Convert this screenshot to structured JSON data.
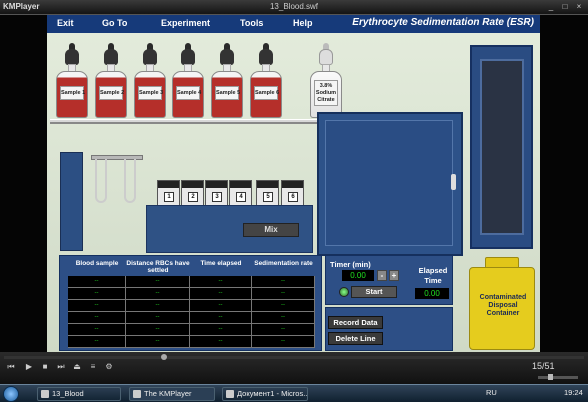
{
  "window": {
    "app_name": "KMPlayer",
    "file_title": "13_Blood.swf",
    "buttons": [
      "_",
      "□",
      "×"
    ]
  },
  "menu": {
    "items": [
      "Exit",
      "Go To",
      "Experiment",
      "Tools",
      "Help"
    ],
    "app_title": "Erythrocyte Sedimentation Rate (ESR)"
  },
  "bottles": [
    "Sample 1",
    "Sample 2",
    "Sample 3",
    "Sample 4",
    "Sample 5",
    "Sample 6"
  ],
  "citrate_label": "3.8% Sodium Citrate",
  "slots": [
    "1",
    "2",
    "3",
    "4",
    "5",
    "6"
  ],
  "mix_label": "Mix",
  "table": {
    "headers": [
      "Blood sample",
      "Distance RBCs have settled",
      "Time elapsed",
      "Sedimentation rate"
    ],
    "rows": [
      [
        "--",
        "--",
        "--",
        "--"
      ],
      [
        "--",
        "--",
        "--",
        "--"
      ],
      [
        "--",
        "--",
        "--",
        "--"
      ],
      [
        "--",
        "--",
        "--",
        "--"
      ],
      [
        "--",
        "--",
        "--",
        "--"
      ],
      [
        "--",
        "--",
        "--",
        "--"
      ]
    ]
  },
  "timer": {
    "label": "Timer (min)",
    "value": "0.00",
    "minus": "-",
    "plus": "+",
    "start_label": "Start",
    "elapsed_label": "Elapsed Time",
    "elapsed_value": "0.00"
  },
  "actions": {
    "record": "Record Data",
    "delete": "Delete Line"
  },
  "disposal_label": "Contaminated Disposal Container",
  "player": {
    "position_text": "15/51",
    "seek_fraction": 0.27,
    "controls": [
      "⏮",
      "▶",
      "■",
      "⏭",
      "⏏",
      "≡",
      "⚙"
    ]
  },
  "taskbar": {
    "items": [
      "13_Blood",
      "The KMPlayer",
      "Документ1 - Micros..."
    ],
    "lang": "RU",
    "clock": "19:24"
  }
}
